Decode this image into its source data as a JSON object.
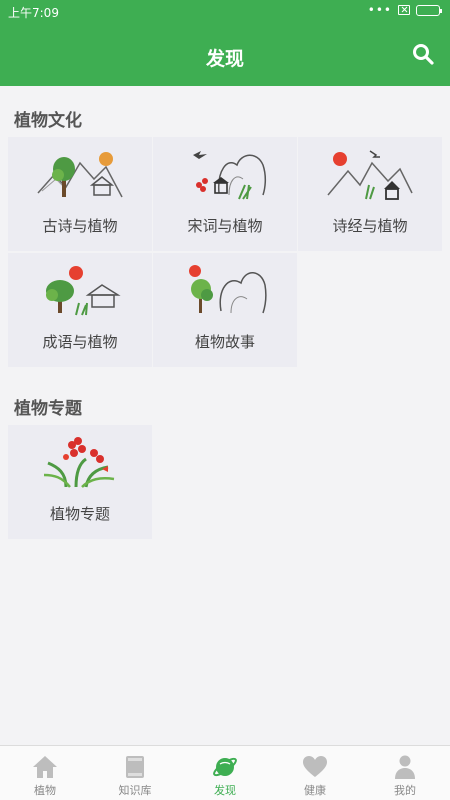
{
  "status_bar": {
    "time": "上午7:09",
    "dots": "•••"
  },
  "header": {
    "title": "发现"
  },
  "sections": [
    {
      "title": "植物文化",
      "items": [
        {
          "label": "古诗与植物"
        },
        {
          "label": "宋词与植物"
        },
        {
          "label": "诗经与植物"
        },
        {
          "label": "成语与植物"
        },
        {
          "label": "植物故事"
        }
      ]
    },
    {
      "title": "植物专题",
      "items": [
        {
          "label": "植物专题"
        }
      ]
    }
  ],
  "bottom_nav": {
    "items": [
      {
        "label": "植物",
        "icon": "home-icon",
        "active": false
      },
      {
        "label": "知识库",
        "icon": "book-icon",
        "active": false
      },
      {
        "label": "发现",
        "icon": "planet-icon",
        "active": true
      },
      {
        "label": "健康",
        "icon": "heart-icon",
        "active": false
      },
      {
        "label": "我的",
        "icon": "person-icon",
        "active": false
      }
    ]
  },
  "colors": {
    "primary": "#3eae52",
    "tile_bg": "#ececf2",
    "page_bg": "#f3f3f5"
  }
}
